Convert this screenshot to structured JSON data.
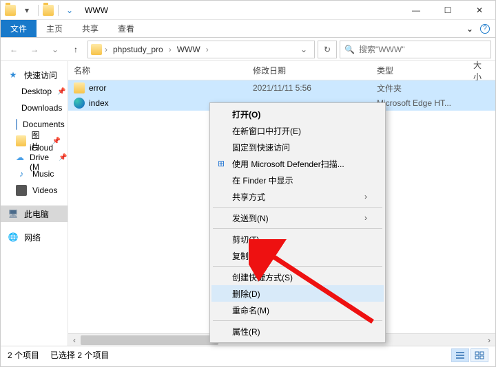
{
  "window": {
    "title": "WWW"
  },
  "ribbon": {
    "file": "文件",
    "home": "主页",
    "share": "共享",
    "view": "查看"
  },
  "breadcrumb": {
    "parent": "phpstudy_pro",
    "current": "WWW"
  },
  "search": {
    "placeholder": "搜索\"WWW\""
  },
  "sidebar": {
    "quick": "快速访问",
    "items": [
      {
        "label": "Desktop"
      },
      {
        "label": "Downloads"
      },
      {
        "label": "Documents"
      },
      {
        "label": "图片"
      },
      {
        "label": "iCloud Drive (M"
      },
      {
        "label": "Music"
      },
      {
        "label": "Videos"
      }
    ],
    "pc": "此电脑",
    "net": "网络"
  },
  "columns": {
    "name": "名称",
    "date": "修改日期",
    "type": "类型",
    "size": "大小"
  },
  "rows": [
    {
      "name": "error",
      "date": "2021/11/11 5:56",
      "type": "文件夹",
      "icon": "folder"
    },
    {
      "name": "index",
      "date": "",
      "type": "Microsoft Edge HT...",
      "icon": "edge"
    }
  ],
  "context_menu": {
    "open": "打开(O)",
    "open_new": "在新窗口中打开(E)",
    "pin_quick": "固定到快速访问",
    "defender": "使用 Microsoft Defender扫描...",
    "finder": "在 Finder 中显示",
    "share": "共享方式",
    "sendto": "发送到(N)",
    "cut": "剪切(T)",
    "copy": "复制(C)",
    "shortcut": "创建快捷方式(S)",
    "delete": "删除(D)",
    "rename": "重命名(M)",
    "properties": "属性(R)"
  },
  "status": {
    "count": "2 个项目",
    "selected": "已选择 2 个项目"
  }
}
